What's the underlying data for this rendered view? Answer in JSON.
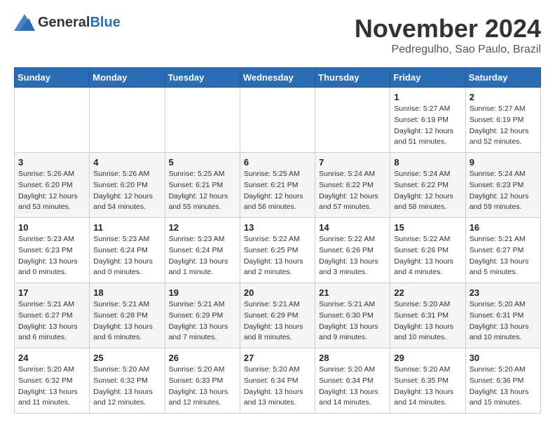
{
  "header": {
    "logo_general": "General",
    "logo_blue": "Blue",
    "title": "November 2024",
    "location": "Pedregulho, Sao Paulo, Brazil"
  },
  "calendar": {
    "days_of_week": [
      "Sunday",
      "Monday",
      "Tuesday",
      "Wednesday",
      "Thursday",
      "Friday",
      "Saturday"
    ],
    "weeks": [
      [
        {
          "day": "",
          "info": ""
        },
        {
          "day": "",
          "info": ""
        },
        {
          "day": "",
          "info": ""
        },
        {
          "day": "",
          "info": ""
        },
        {
          "day": "",
          "info": ""
        },
        {
          "day": "1",
          "info": "Sunrise: 5:27 AM\nSunset: 6:19 PM\nDaylight: 12 hours\nand 51 minutes."
        },
        {
          "day": "2",
          "info": "Sunrise: 5:27 AM\nSunset: 6:19 PM\nDaylight: 12 hours\nand 52 minutes."
        }
      ],
      [
        {
          "day": "3",
          "info": "Sunrise: 5:26 AM\nSunset: 6:20 PM\nDaylight: 12 hours\nand 53 minutes."
        },
        {
          "day": "4",
          "info": "Sunrise: 5:26 AM\nSunset: 6:20 PM\nDaylight: 12 hours\nand 54 minutes."
        },
        {
          "day": "5",
          "info": "Sunrise: 5:25 AM\nSunset: 6:21 PM\nDaylight: 12 hours\nand 55 minutes."
        },
        {
          "day": "6",
          "info": "Sunrise: 5:25 AM\nSunset: 6:21 PM\nDaylight: 12 hours\nand 56 minutes."
        },
        {
          "day": "7",
          "info": "Sunrise: 5:24 AM\nSunset: 6:22 PM\nDaylight: 12 hours\nand 57 minutes."
        },
        {
          "day": "8",
          "info": "Sunrise: 5:24 AM\nSunset: 6:22 PM\nDaylight: 12 hours\nand 58 minutes."
        },
        {
          "day": "9",
          "info": "Sunrise: 5:24 AM\nSunset: 6:23 PM\nDaylight: 12 hours\nand 59 minutes."
        }
      ],
      [
        {
          "day": "10",
          "info": "Sunrise: 5:23 AM\nSunset: 6:23 PM\nDaylight: 13 hours\nand 0 minutes."
        },
        {
          "day": "11",
          "info": "Sunrise: 5:23 AM\nSunset: 6:24 PM\nDaylight: 13 hours\nand 0 minutes."
        },
        {
          "day": "12",
          "info": "Sunrise: 5:23 AM\nSunset: 6:24 PM\nDaylight: 13 hours\nand 1 minute."
        },
        {
          "day": "13",
          "info": "Sunrise: 5:22 AM\nSunset: 6:25 PM\nDaylight: 13 hours\nand 2 minutes."
        },
        {
          "day": "14",
          "info": "Sunrise: 5:22 AM\nSunset: 6:26 PM\nDaylight: 13 hours\nand 3 minutes."
        },
        {
          "day": "15",
          "info": "Sunrise: 5:22 AM\nSunset: 6:26 PM\nDaylight: 13 hours\nand 4 minutes."
        },
        {
          "day": "16",
          "info": "Sunrise: 5:21 AM\nSunset: 6:27 PM\nDaylight: 13 hours\nand 5 minutes."
        }
      ],
      [
        {
          "day": "17",
          "info": "Sunrise: 5:21 AM\nSunset: 6:27 PM\nDaylight: 13 hours\nand 6 minutes."
        },
        {
          "day": "18",
          "info": "Sunrise: 5:21 AM\nSunset: 6:28 PM\nDaylight: 13 hours\nand 6 minutes."
        },
        {
          "day": "19",
          "info": "Sunrise: 5:21 AM\nSunset: 6:29 PM\nDaylight: 13 hours\nand 7 minutes."
        },
        {
          "day": "20",
          "info": "Sunrise: 5:21 AM\nSunset: 6:29 PM\nDaylight: 13 hours\nand 8 minutes."
        },
        {
          "day": "21",
          "info": "Sunrise: 5:21 AM\nSunset: 6:30 PM\nDaylight: 13 hours\nand 9 minutes."
        },
        {
          "day": "22",
          "info": "Sunrise: 5:20 AM\nSunset: 6:31 PM\nDaylight: 13 hours\nand 10 minutes."
        },
        {
          "day": "23",
          "info": "Sunrise: 5:20 AM\nSunset: 6:31 PM\nDaylight: 13 hours\nand 10 minutes."
        }
      ],
      [
        {
          "day": "24",
          "info": "Sunrise: 5:20 AM\nSunset: 6:32 PM\nDaylight: 13 hours\nand 11 minutes."
        },
        {
          "day": "25",
          "info": "Sunrise: 5:20 AM\nSunset: 6:32 PM\nDaylight: 13 hours\nand 12 minutes."
        },
        {
          "day": "26",
          "info": "Sunrise: 5:20 AM\nSunset: 6:33 PM\nDaylight: 13 hours\nand 12 minutes."
        },
        {
          "day": "27",
          "info": "Sunrise: 5:20 AM\nSunset: 6:34 PM\nDaylight: 13 hours\nand 13 minutes."
        },
        {
          "day": "28",
          "info": "Sunrise: 5:20 AM\nSunset: 6:34 PM\nDaylight: 13 hours\nand 14 minutes."
        },
        {
          "day": "29",
          "info": "Sunrise: 5:20 AM\nSunset: 6:35 PM\nDaylight: 13 hours\nand 14 minutes."
        },
        {
          "day": "30",
          "info": "Sunrise: 5:20 AM\nSunset: 6:36 PM\nDaylight: 13 hours\nand 15 minutes."
        }
      ]
    ]
  }
}
